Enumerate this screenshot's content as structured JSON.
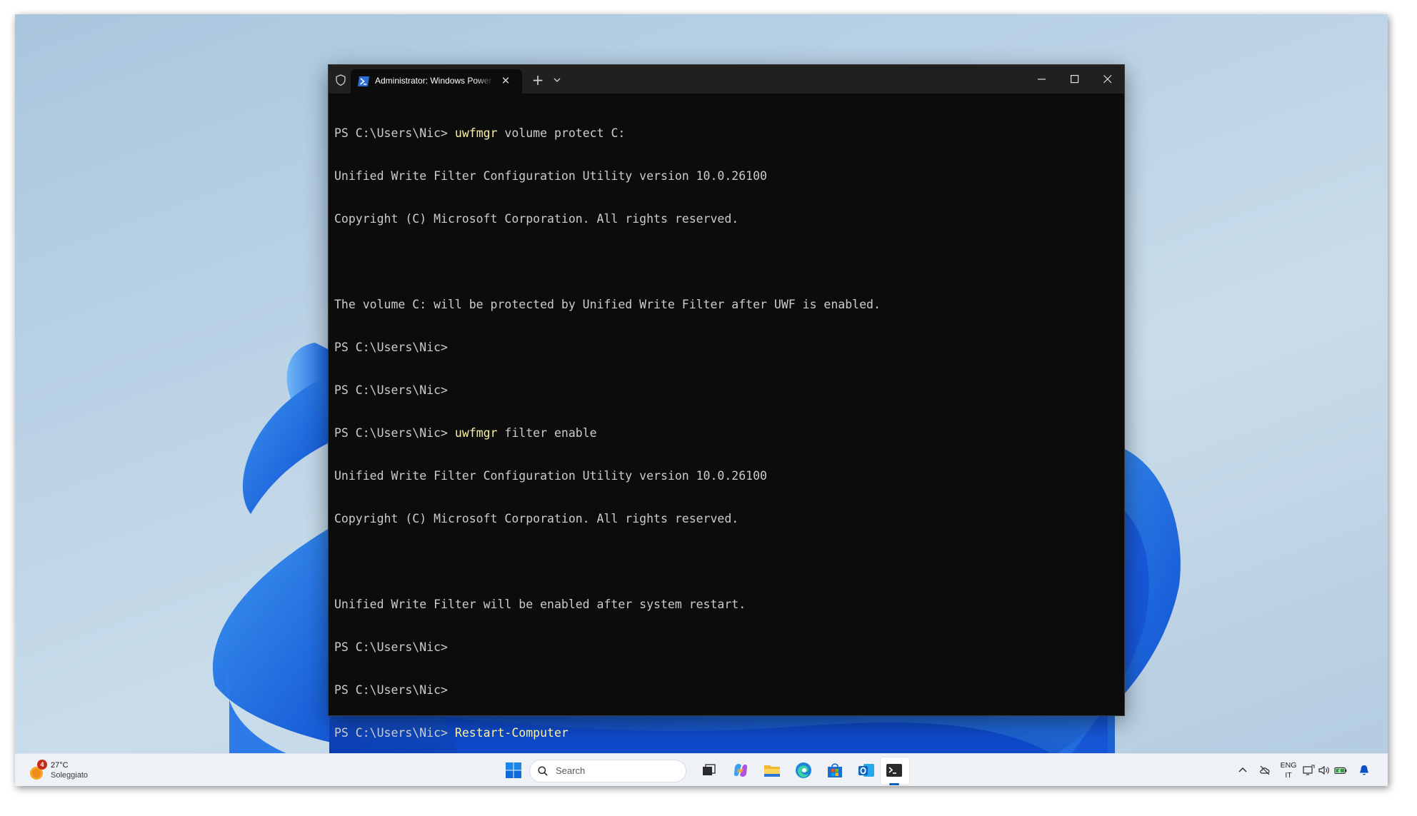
{
  "terminal": {
    "tab_title": "Administrator: Windows PowerShell",
    "lines": [
      {
        "prompt": "PS C:\\Users\\Nic> ",
        "cmd_name": "uwfmgr",
        "cmd_args": " volume protect C:"
      },
      {
        "text": "Unified Write Filter Configuration Utility version 10.0.26100"
      },
      {
        "text": "Copyright (C) Microsoft Corporation. All rights reserved."
      },
      {
        "text": ""
      },
      {
        "text": "The volume C: will be protected by Unified Write Filter after UWF is enabled."
      },
      {
        "prompt": "PS C:\\Users\\Nic>"
      },
      {
        "prompt": "PS C:\\Users\\Nic>"
      },
      {
        "prompt": "PS C:\\Users\\Nic> ",
        "cmd_name": "uwfmgr",
        "cmd_args": " filter enable"
      },
      {
        "text": "Unified Write Filter Configuration Utility version 10.0.26100"
      },
      {
        "text": "Copyright (C) Microsoft Corporation. All rights reserved."
      },
      {
        "text": ""
      },
      {
        "text": "Unified Write Filter will be enabled after system restart."
      },
      {
        "prompt": "PS C:\\Users\\Nic>"
      },
      {
        "prompt": "PS C:\\Users\\Nic>"
      },
      {
        "prompt": "PS C:\\Users\\Nic> ",
        "cmd_name": "Restart-Computer",
        "cmd_args": ""
      }
    ]
  },
  "taskbar": {
    "weather": {
      "badge": "4",
      "temperature": "27°C",
      "condition": "Soleggiato"
    },
    "search_placeholder": "Search",
    "pinned_apps": [
      "start-icon",
      "task-view-icon",
      "copilot-icon",
      "file-explorer-icon",
      "edge-icon",
      "store-icon",
      "outlook-icon",
      "terminal-icon"
    ],
    "tray": {
      "language_line1": "ENG",
      "language_line2": "IT"
    }
  },
  "colors": {
    "terminal_bg": "#0c0c0c",
    "titlebar_bg": "#202020",
    "console_text": "#cccccc",
    "command_highlight": "#f9f1a5",
    "taskbar_bg": "#eef1f5",
    "accent": "#005fb8"
  }
}
